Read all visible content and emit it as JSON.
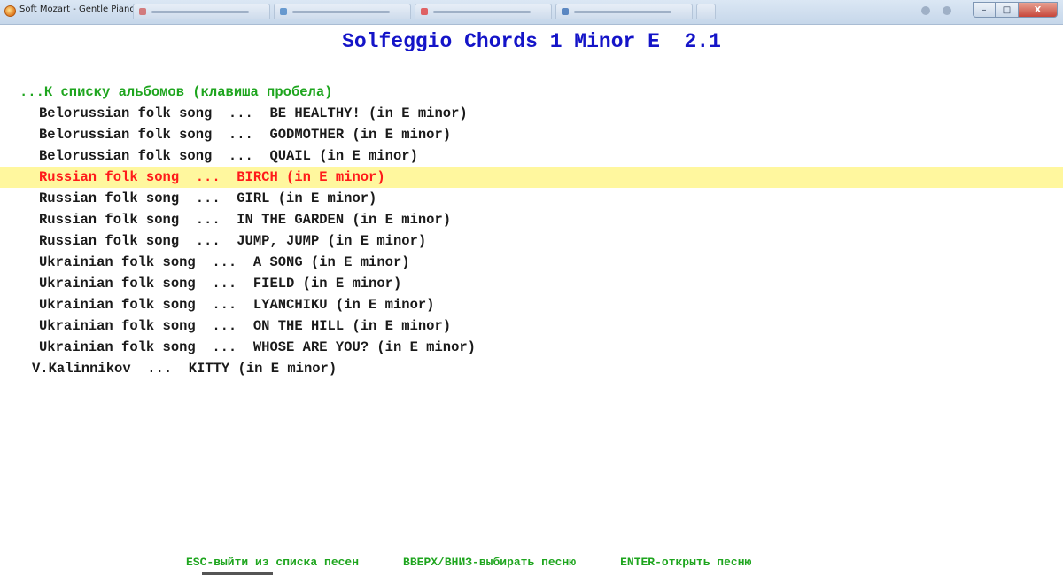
{
  "window": {
    "title": "Soft Mozart - Gentle Piano",
    "controls": {
      "minimize": "–",
      "maximize": "□",
      "close": "X"
    }
  },
  "header": {
    "title": "Solfeggio Chords 1 Minor E  2.1"
  },
  "back_link": "...К списку альбомов (клавиша пробела)",
  "songs": [
    {
      "text": "Belorussian folk song  ...  BE HEALTHY! (in E minor)"
    },
    {
      "text": "Belorussian folk song  ...  GODMOTHER (in E minor)"
    },
    {
      "text": "Belorussian folk song  ...  QUAIL (in E minor)"
    },
    {
      "text": "Russian folk song  ...  BIRCH (in E minor)"
    },
    {
      "text": "Russian folk song  ...  GIRL (in E minor)"
    },
    {
      "text": "Russian folk song  ...  IN THE GARDEN (in E minor)"
    },
    {
      "text": "Russian folk song  ...  JUMP, JUMP (in E minor)"
    },
    {
      "text": "Ukrainian folk song  ...  A SONG (in E minor)"
    },
    {
      "text": "Ukrainian folk song  ...  FIELD (in E minor)"
    },
    {
      "text": "Ukrainian folk song  ...  LYANCHIKU (in E minor)"
    },
    {
      "text": "Ukrainian folk song  ...  ON THE HILL (in E minor)"
    },
    {
      "text": "Ukrainian folk song  ...  WHOSE ARE YOU? (in E minor)"
    },
    {
      "text": "V.Kalinnikov  ...  KITTY (in E minor)"
    }
  ],
  "selected_index": 3,
  "footer": {
    "esc_hint": "ESC-выйти из списка песен",
    "arrows_hint": "ВВЕРХ/ВНИЗ-выбирать песню",
    "enter_hint": "ENTER-открыть песню"
  },
  "colors": {
    "title": "#1414c8",
    "hint_green": "#1ea51e",
    "selected_text": "#ff1a1a",
    "selected_bg": "#fff79e"
  }
}
